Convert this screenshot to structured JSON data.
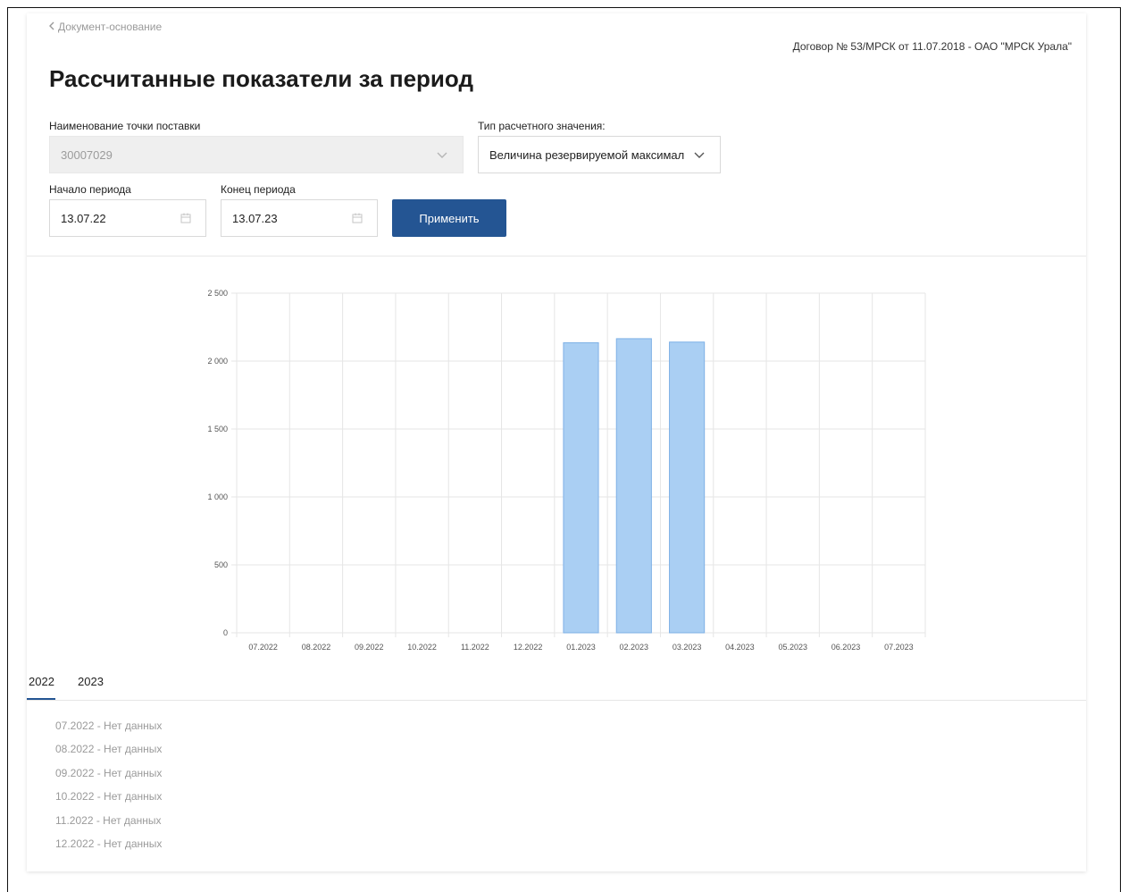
{
  "back_link": "Документ-основание",
  "contract": "Договор № 53/МРСК от 11.07.2018 - ОАО \"МРСК Урала\"",
  "title": "Рассчитанные показатели за период",
  "filters": {
    "point_label": "Наименование точки поставки",
    "point_value": "30007029",
    "type_label": "Тип расчетного значения:",
    "type_value": "Величина резервируемой максимальн",
    "start_label": "Начало периода",
    "start_value": "13.07.22",
    "end_label": "Конец периода",
    "end_value": "13.07.23",
    "apply_label": "Применить"
  },
  "colors": {
    "accent": "#245593",
    "bar_fill": "#aacff3",
    "bar_stroke": "#7fb1e6"
  },
  "chart_data": {
    "type": "bar",
    "categories": [
      "07.2022",
      "08.2022",
      "09.2022",
      "10.2022",
      "11.2022",
      "12.2022",
      "01.2023",
      "02.2023",
      "03.2023",
      "04.2023",
      "05.2023",
      "06.2023",
      "07.2023"
    ],
    "values": [
      null,
      null,
      null,
      null,
      null,
      null,
      2135,
      2165,
      2140,
      null,
      null,
      null,
      null
    ],
    "y_ticks": [
      "0",
      "500",
      "1 000",
      "1 500",
      "2 000",
      "2 500"
    ],
    "ylim": [
      0,
      2500
    ],
    "grid": true,
    "title": "",
    "xlabel": "",
    "ylabel": ""
  },
  "tabs": [
    "2022",
    "2023"
  ],
  "active_tab": "2022",
  "data_rows": [
    "07.2022 - Нет данных",
    "08.2022 - Нет данных",
    "09.2022 - Нет данных",
    "10.2022 - Нет данных",
    "11.2022 - Нет данных",
    "12.2022 - Нет данных"
  ]
}
